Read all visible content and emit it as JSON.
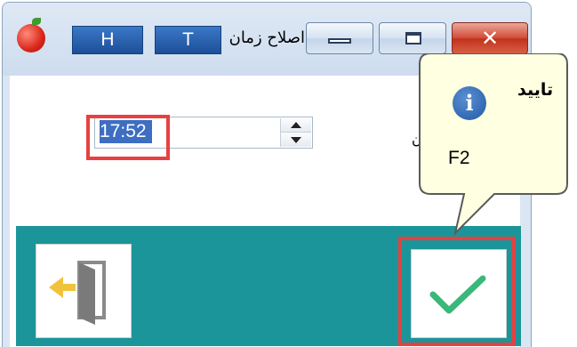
{
  "window": {
    "title": "اصلاح زمان",
    "shortcut_h": "H",
    "shortcut_t": "T",
    "close_symbol": "✕"
  },
  "form": {
    "field_label_fragment": "ن",
    "time_value": "17:52"
  },
  "tooltip": {
    "title": "تایید",
    "info_symbol": "i",
    "shortcut": "F2"
  },
  "actions": {
    "exit_icon": "exit-door-icon",
    "confirm_icon": "checkmark-icon"
  },
  "colors": {
    "accent_teal": "#1b9599",
    "highlight": "#e84040",
    "confirm_check": "#3ab87a",
    "tooltip_bg": "#ffffe1"
  }
}
